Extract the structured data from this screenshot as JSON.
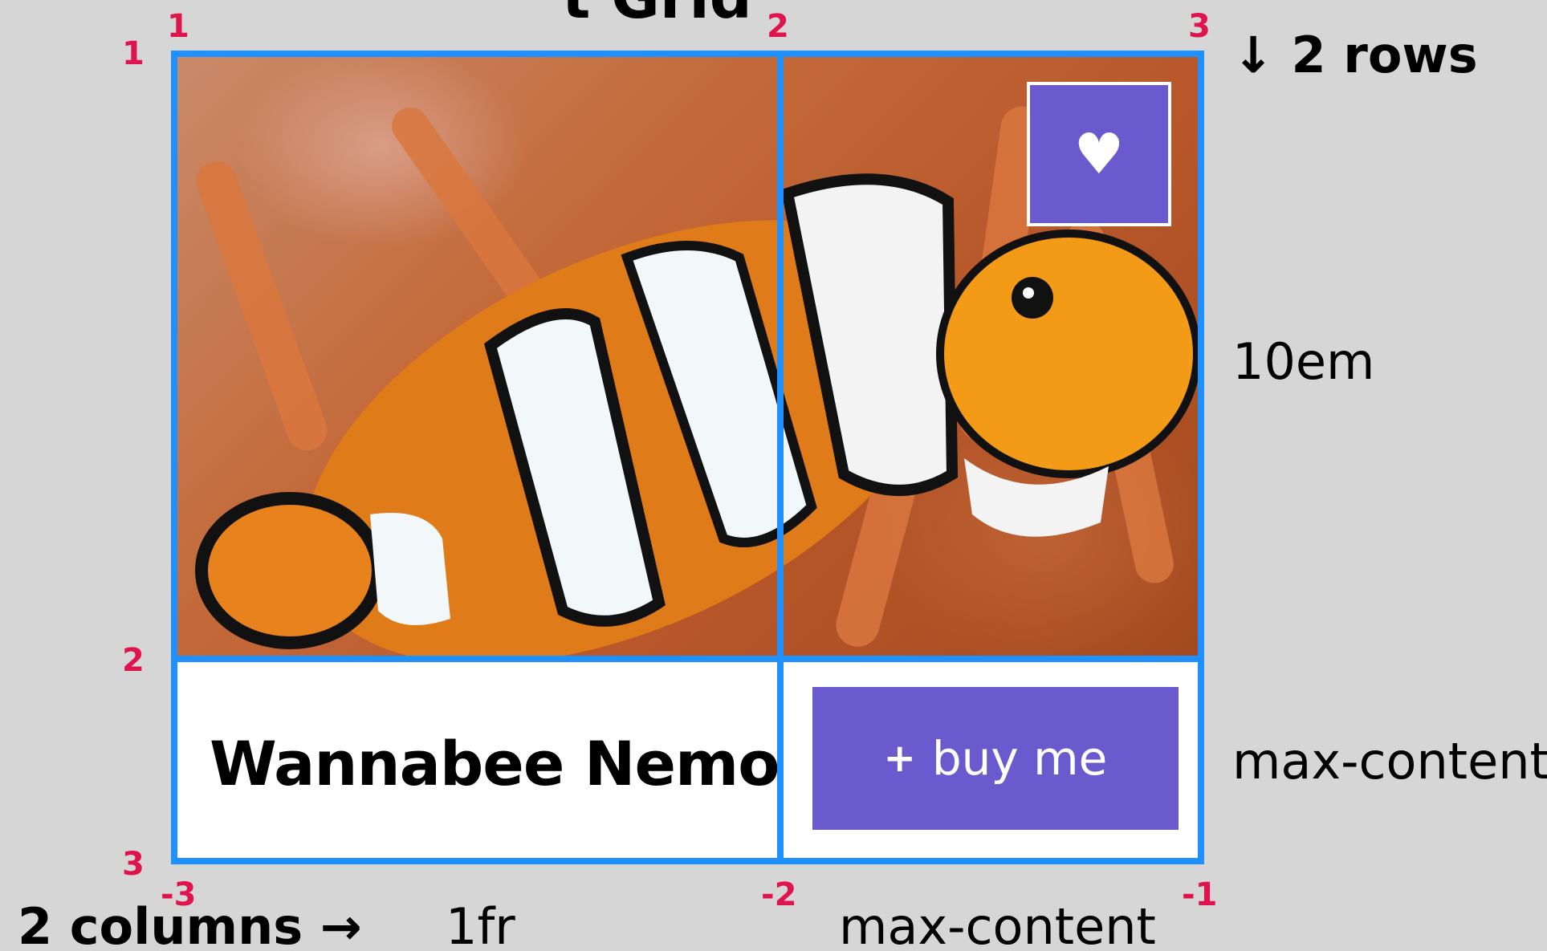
{
  "title": "t Grid",
  "rows_label": "↓ 2 rows",
  "columns_label": "2 columns →",
  "row_tracks": [
    "10em",
    "max-content"
  ],
  "column_tracks": [
    "1fr",
    "max-content"
  ],
  "card": {
    "name": "Wannabee Nemo",
    "buy_plus": "+",
    "buy_label": "buy me",
    "favorite_symbol": "♥"
  },
  "line_numbers": {
    "top_columns": [
      "1",
      "2",
      "3"
    ],
    "left_rows": [
      "1",
      "2",
      "3"
    ],
    "bottom_columns": [
      "-3",
      "-2",
      "-1"
    ]
  },
  "colors": {
    "grid_line": "#1e90ff",
    "line_number": "#e0144c",
    "button": "#6b5acd",
    "background": "#d6d6d6"
  }
}
